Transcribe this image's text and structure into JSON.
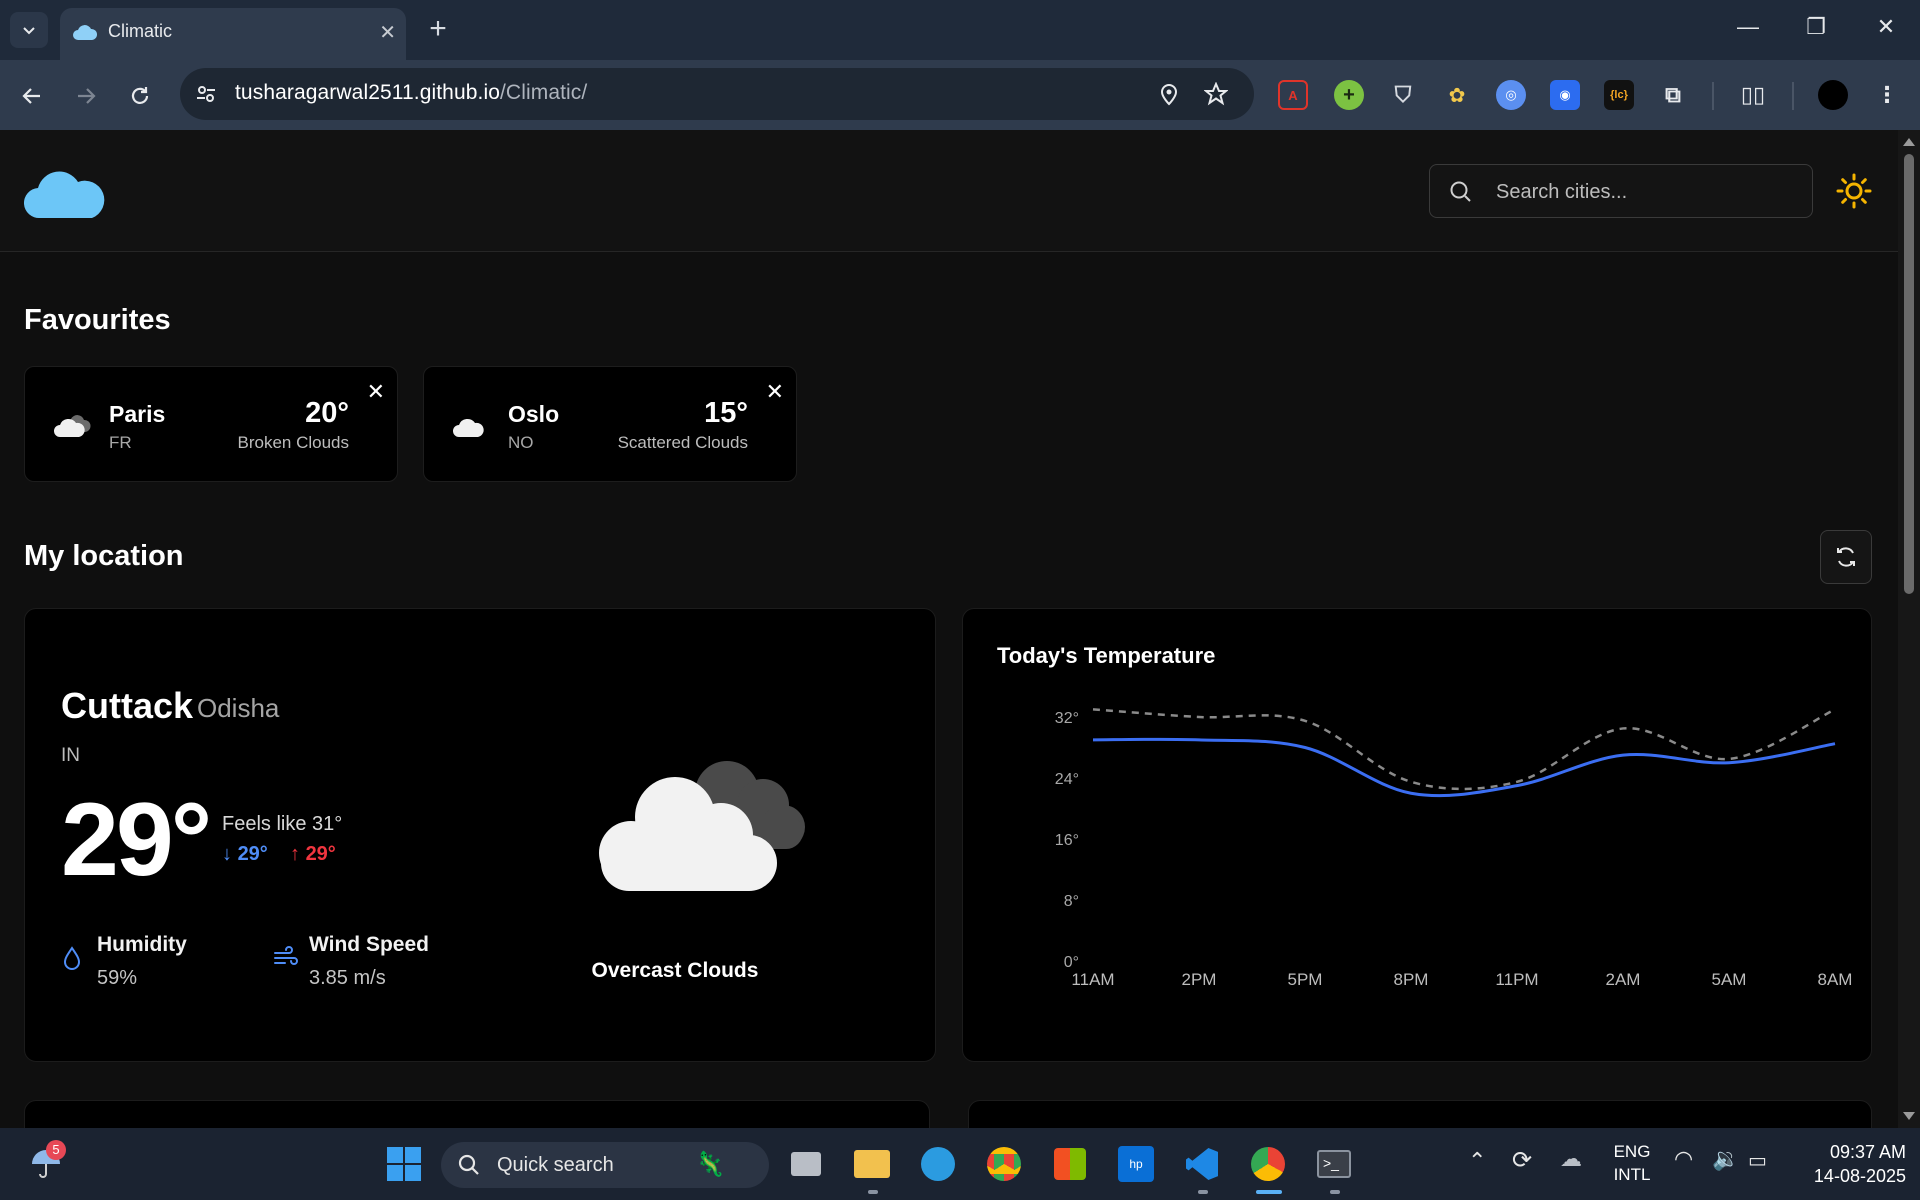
{
  "browser": {
    "tab_title": "Climatic",
    "url_host": "tusharagarwal2511.github.io",
    "url_path": "/Climatic/"
  },
  "header": {
    "search_placeholder": "Search cities..."
  },
  "favourites": {
    "title": "Favourites",
    "cards": [
      {
        "city": "Paris",
        "country": "FR",
        "temp": "20°",
        "desc": "Broken Clouds"
      },
      {
        "city": "Oslo",
        "country": "NO",
        "temp": "15°",
        "desc": "Scattered Clouds"
      }
    ]
  },
  "my_location": {
    "title": "My location",
    "city": "Cuttack",
    "region": "Odisha",
    "country": "IN",
    "temp": "29°",
    "feels_like": "Feels like 31°",
    "temp_min": "29°",
    "temp_max": "29°",
    "humidity_label": "Humidity",
    "humidity_value": "59%",
    "wind_label": "Wind Speed",
    "wind_value": "3.85 m/s",
    "condition": "Overcast Clouds"
  },
  "chart_data": {
    "type": "line",
    "title": "Today's Temperature",
    "x": [
      "11AM",
      "2PM",
      "5PM",
      "8PM",
      "11PM",
      "2AM",
      "5AM",
      "8AM"
    ],
    "y_ticks": [
      "32°",
      "24°",
      "16°",
      "8°",
      "0°"
    ],
    "ylim": [
      0,
      32
    ],
    "grid": false,
    "series": [
      {
        "style": "solid",
        "color": "#3b6ef2",
        "values": [
          29,
          29,
          28,
          22,
          23,
          27,
          26,
          28.5
        ]
      },
      {
        "style": "dashed",
        "color": "#8a8a8a",
        "values": [
          33,
          32,
          31.5,
          23.5,
          23.5,
          30.5,
          26.5,
          33
        ]
      }
    ]
  },
  "taskbar": {
    "weather_badge": "5",
    "search_label": "Quick search",
    "lang_line1": "ENG",
    "lang_line2": "INTL",
    "time": "09:37 AM",
    "date": "14-08-2025"
  },
  "colors": {
    "accent_blue": "#4f8df7",
    "hi_red": "#f0353f",
    "sun_yellow": "#f5b400",
    "logo_blue": "#6cc6f7"
  }
}
